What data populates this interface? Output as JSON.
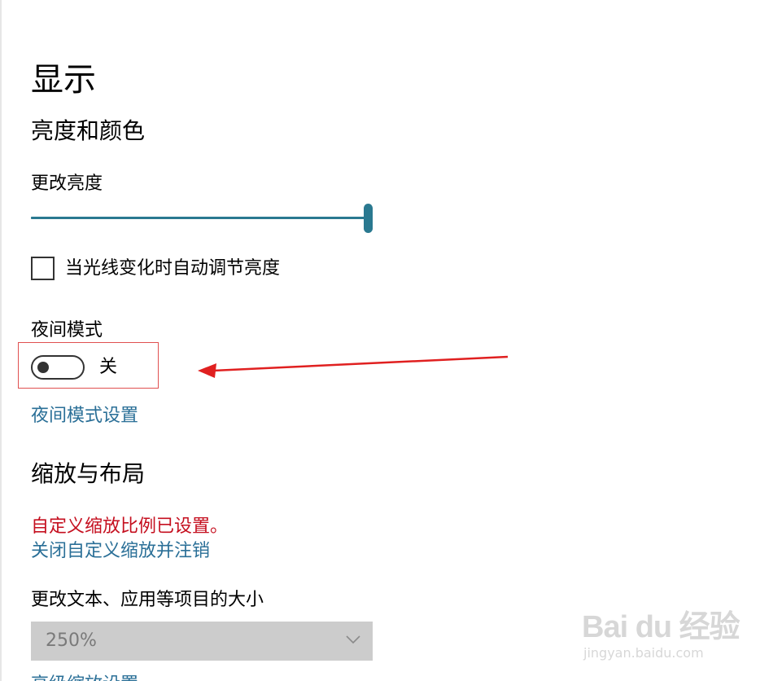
{
  "page": {
    "title": "显示"
  },
  "brightness": {
    "section_title": "亮度和颜色",
    "label": "更改亮度",
    "value_percent": 100,
    "auto_adjust_label": "当光线变化时自动调节亮度",
    "auto_adjust_checked": false
  },
  "night_mode": {
    "label": "夜间模式",
    "state_label": "关",
    "is_on": false,
    "settings_link": "夜间模式设置"
  },
  "scale_layout": {
    "section_title": "缩放与布局",
    "warning": "自定义缩放比例已设置。",
    "signout_link": "关闭自定义缩放并注销",
    "size_label": "更改文本、应用等项目的大小",
    "size_value": "250%",
    "advanced_link": "高级缩放设置"
  },
  "watermark": {
    "logo": "Bai du 经验",
    "url": "jingyan.baidu.com"
  },
  "colors": {
    "accent": "#2a7990",
    "link": "#2a6f97",
    "warning": "#c50f1f",
    "annotation": "#e02020"
  },
  "icons": {
    "dropdown": "chevron-down-icon",
    "annotation": "arrow-left-icon"
  }
}
